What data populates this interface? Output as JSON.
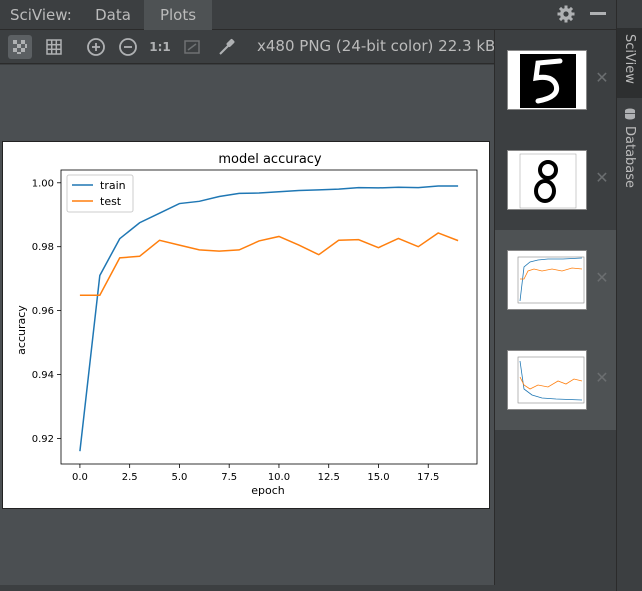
{
  "app": {
    "title": "SciView:"
  },
  "tabs": [
    {
      "label": "Data",
      "active": false
    },
    {
      "label": "Plots",
      "active": true
    }
  ],
  "toolbar": {
    "actual_size_label": "1:1",
    "image_info": "x480 PNG (24-bit color) 22.3 kB",
    "icons": [
      "chessboard-icon",
      "grid-icon",
      "zoom-in-icon",
      "zoom-out-icon",
      "actual-size-icon",
      "fit-window-icon",
      "color-picker-icon"
    ]
  },
  "side_stripe": {
    "sciview_label": "SciView",
    "database_label": "Database"
  },
  "thumbnails": [
    {
      "name": "digit-5",
      "selected": false
    },
    {
      "name": "digit-8",
      "selected": false
    },
    {
      "name": "accuracy-plot",
      "selected": true
    },
    {
      "name": "loss-plot",
      "selected": true
    }
  ],
  "colors": {
    "train": "#1f77b4",
    "test": "#ff7f0e",
    "panel": "#3c3f41",
    "view_bg": "#4b4f52"
  },
  "chart_data": {
    "type": "line",
    "title": "model accuracy",
    "xlabel": "epoch",
    "ylabel": "accuracy",
    "xlim": [
      -0.95,
      19.95
    ],
    "ylim": [
      0.912,
      1.004
    ],
    "xticks": [
      0.0,
      2.5,
      5.0,
      7.5,
      10.0,
      12.5,
      15.0,
      17.5
    ],
    "xtick_labels": [
      "0.0",
      "2.5",
      "5.0",
      "7.5",
      "10.0",
      "12.5",
      "15.0",
      "17.5"
    ],
    "yticks": [
      0.92,
      0.94,
      0.96,
      0.98,
      1.0
    ],
    "ytick_labels": [
      "0.92",
      "0.94",
      "0.96",
      "0.98",
      "1.00"
    ],
    "grid": false,
    "legend": "top-left",
    "x": [
      0,
      1,
      2,
      3,
      4,
      5,
      6,
      7,
      8,
      9,
      10,
      11,
      12,
      13,
      14,
      15,
      16,
      17,
      18,
      19
    ],
    "series": [
      {
        "name": "train",
        "color": "#1f77b4",
        "values": [
          0.916,
          0.971,
          0.9825,
          0.9875,
          0.9905,
          0.9935,
          0.9942,
          0.9957,
          0.9967,
          0.9968,
          0.9972,
          0.9976,
          0.9978,
          0.998,
          0.9985,
          0.9984,
          0.9986,
          0.9985,
          0.999,
          0.999
        ]
      },
      {
        "name": "test",
        "color": "#ff7f0e",
        "values": [
          0.9648,
          0.9648,
          0.9765,
          0.977,
          0.982,
          0.9805,
          0.979,
          0.9786,
          0.979,
          0.9818,
          0.9832,
          0.9805,
          0.9775,
          0.982,
          0.9822,
          0.9797,
          0.9826,
          0.98,
          0.9843,
          0.9819
        ]
      }
    ]
  }
}
